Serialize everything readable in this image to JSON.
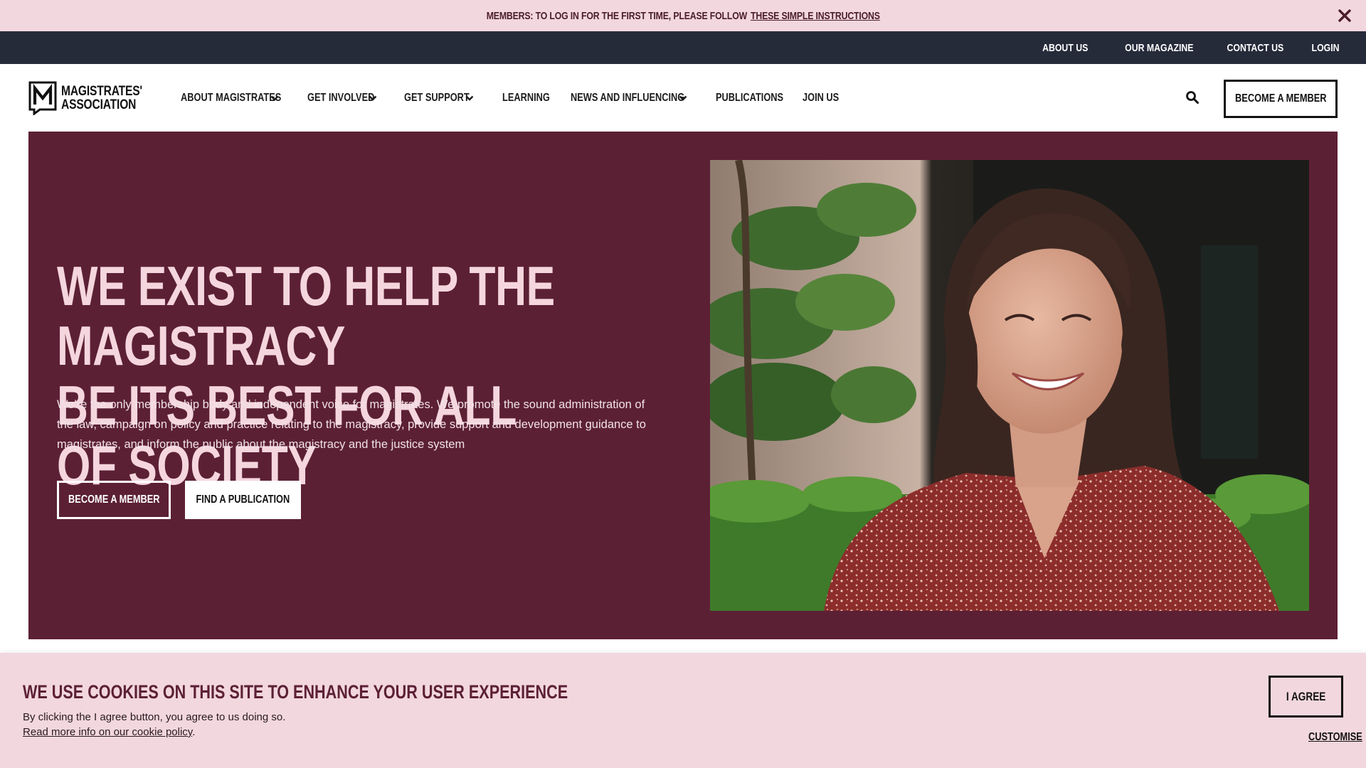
{
  "notice": {
    "text": "MEMBERS: TO LOG IN FOR THE FIRST TIME, PLEASE FOLLOW",
    "link": "THESE SIMPLE INSTRUCTIONS"
  },
  "utility_nav": [
    "ABOUT US",
    "OUR MAGAZINE",
    "CONTACT US",
    "LOGIN"
  ],
  "logo": {
    "line1": "MAGISTRATES'",
    "line2": "ASSOCIATION",
    "mark": "M"
  },
  "main_nav": [
    {
      "label": "ABOUT MAGISTRATES",
      "dropdown": true
    },
    {
      "label": "GET INVOLVED",
      "dropdown": true
    },
    {
      "label": "GET SUPPORT",
      "dropdown": true
    },
    {
      "label": "LEARNING",
      "dropdown": false
    },
    {
      "label": "NEWS AND INFLUENCING",
      "dropdown": true
    },
    {
      "label": "PUBLICATIONS",
      "dropdown": false
    },
    {
      "label": "JOIN US",
      "dropdown": false
    }
  ],
  "header": {
    "cta": "BECOME A MEMBER",
    "search_icon": "search-icon"
  },
  "hero": {
    "title_line1": "WE EXIST TO HELP THE MAGISTRACY",
    "title_line2": "BE ITS BEST FOR ALL OF SOCIETY",
    "text": "We're the only membership body and independent voice for magistrates. We promote the sound administration of the law, campaign on policy and practice relating to the magistracy, provide support and development guidance to magistrates, and inform the public about the magistracy and the justice system",
    "btn_primary": "BECOME A MEMBER",
    "btn_secondary": "FIND A PUBLICATION"
  },
  "cookie": {
    "title": "WE USE COOKIES ON THIS SITE TO ENHANCE YOUR USER EXPERIENCE",
    "text": "By clicking the I agree button, you agree to us doing so.",
    "link": "Read more info on our cookie policy",
    "link_suffix": ".",
    "agree": "I AGREE",
    "customise": "CUSTOMISE"
  },
  "colors": {
    "brand": "#5c2035",
    "notice_bg": "#f2d7de",
    "utility_bg": "#262b3a",
    "hero_title": "#f5d6de"
  }
}
